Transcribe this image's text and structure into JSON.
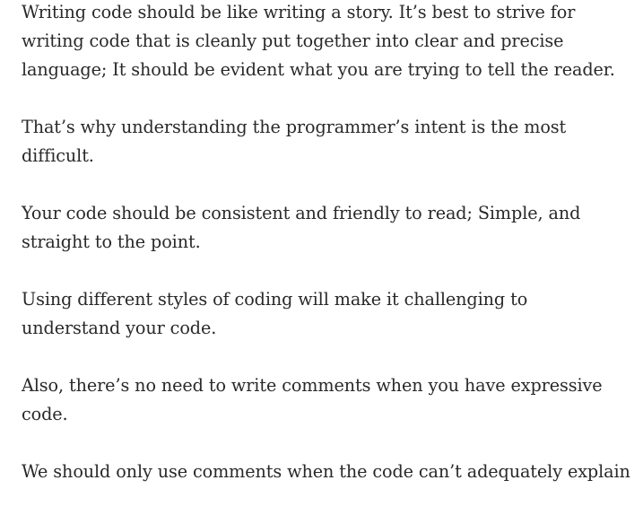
{
  "paragraphs": [
    "Writing code should be like writing a story. It’s best to strive for writing code that is cleanly put together into clear and precise language; It should be evident what you are trying to tell the reader.",
    "That’s why understanding the programmer’s intent is the most difficult.",
    "Your code should be consistent and friendly to read; Simple, and straight to the point.",
    "Using different styles of coding will make it challenging to understand your code.",
    "Also, there’s no need to write comments when you have expressive code.",
    "We should only use comments when the code can’t adequately explain"
  ]
}
